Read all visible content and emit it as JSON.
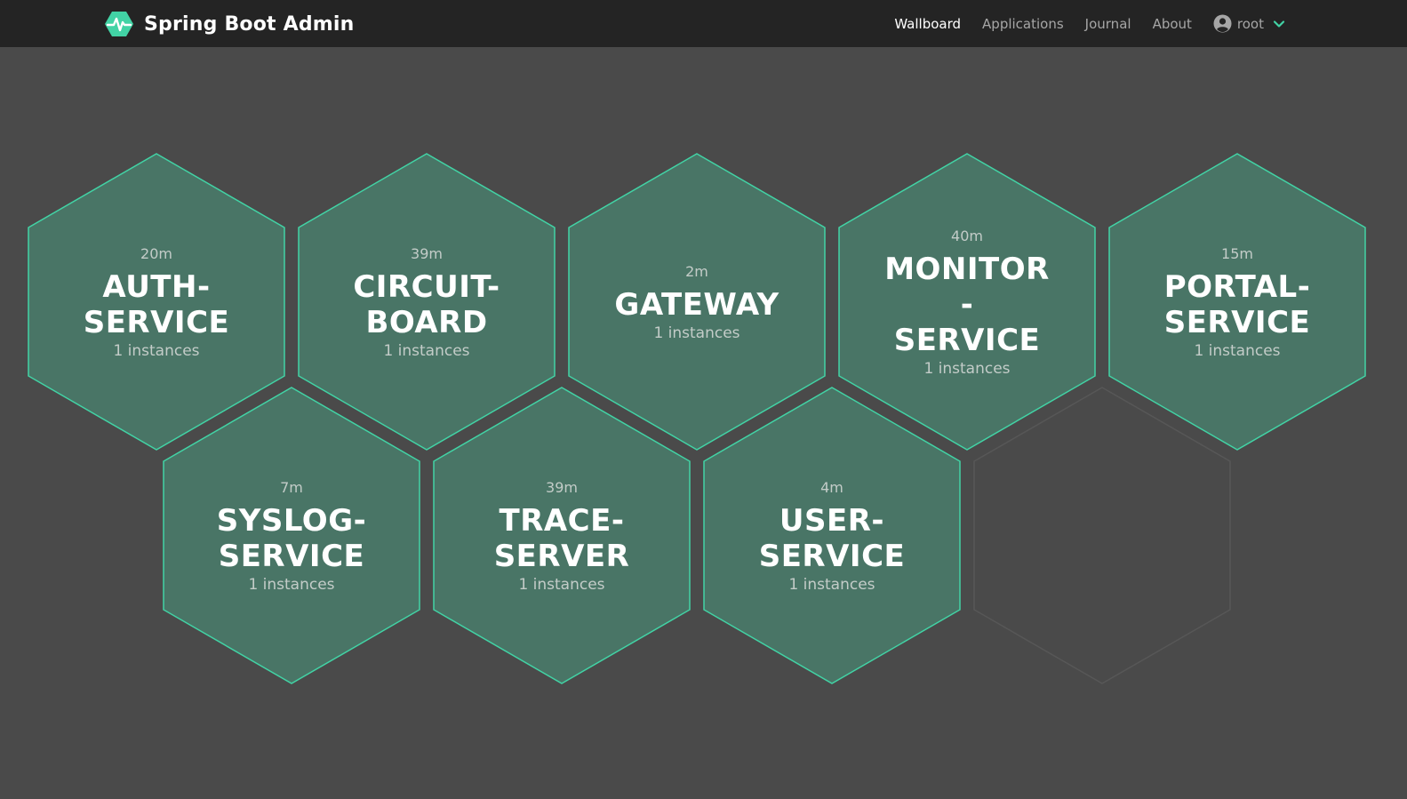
{
  "app": {
    "title": "Spring Boot Admin",
    "icon": "heartbeat-icon",
    "accent_color": "#42d3a5"
  },
  "nav": {
    "items": [
      {
        "label": "Wallboard",
        "active": true
      },
      {
        "label": "Applications",
        "active": false
      },
      {
        "label": "Journal",
        "active": false
      },
      {
        "label": "About",
        "active": false
      }
    ],
    "user": {
      "name": "root",
      "icon": "user-circle-icon",
      "dropdown_icon": "chevron-down-icon"
    }
  },
  "wallboard": {
    "hex_fill": "#497566",
    "hex_stroke": "#42d3a5",
    "empty_stroke": "#575757",
    "applications": [
      {
        "uptime": "20m",
        "name": "AUTH-SERVICE",
        "line1": "AUTH-",
        "line2": "SERVICE",
        "instances": "1 instances"
      },
      {
        "uptime": "39m",
        "name": "CIRCUIT-BOARD",
        "line1": "CIRCUIT-",
        "line2": "BOARD",
        "instances": "1 instances"
      },
      {
        "uptime": "2m",
        "name": "GATEWAY",
        "line1": "GATEWAY",
        "line2": "",
        "instances": "1 instances"
      },
      {
        "uptime": "40m",
        "name": "MONITOR-SERVICE",
        "line1": "MONITOR-",
        "line2": "SERVICE",
        "instances": "1 instances"
      },
      {
        "uptime": "15m",
        "name": "PORTAL-SERVICE",
        "line1": "PORTAL-",
        "line2": "SERVICE",
        "instances": "1 instances"
      },
      {
        "uptime": "7m",
        "name": "SYSLOG-SERVICE",
        "line1": "SYSLOG-",
        "line2": "SERVICE",
        "instances": "1 instances"
      },
      {
        "uptime": "39m",
        "name": "TRACE-SERVER",
        "line1": "TRACE-",
        "line2": "SERVER",
        "instances": "1 instances"
      },
      {
        "uptime": "4m",
        "name": "USER-SERVICE",
        "line1": "USER-",
        "line2": "SERVICE",
        "instances": "1 instances"
      }
    ]
  }
}
